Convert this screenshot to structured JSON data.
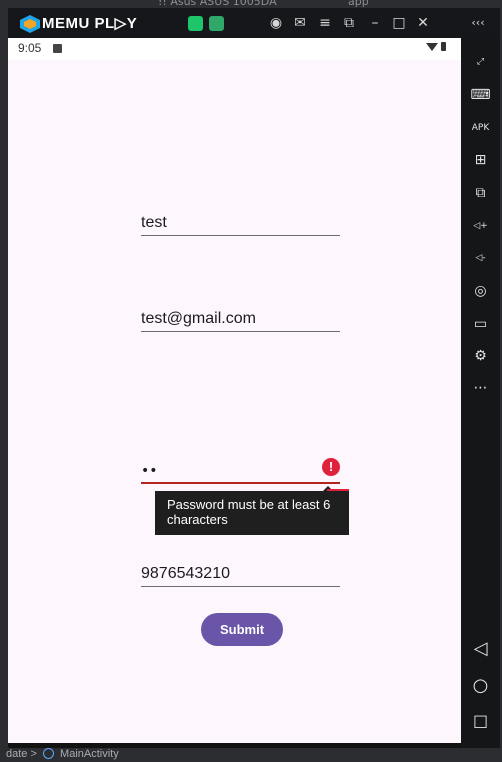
{
  "ide": {
    "top_text_left": "!! Asus ASUS 1005DA",
    "top_text_right": "app",
    "breadcrumb_left": "date",
    "breadcrumb_sep": ">",
    "breadcrumb_item": "MainActivity"
  },
  "emulator": {
    "brand": "MEMU PL▷Y",
    "titlebar_icons": [
      "account-icon",
      "mail-icon",
      "menu-icon",
      "screen-icon",
      "minimize-icon",
      "maximize-icon",
      "close-icon",
      "collapse-icon"
    ],
    "titlebar_glyphs": [
      "◉",
      "✉",
      "≡",
      "⧉",
      "–",
      "□",
      "✕",
      "‹‹‹"
    ],
    "sidebar_icons": [
      "fullscreen-icon",
      "keyboard-icon",
      "apk-icon",
      "add-app-icon",
      "multi-window-icon",
      "volume-up-icon",
      "volume-down-icon",
      "location-icon",
      "folder-icon",
      "settings-icon",
      "more-icon"
    ],
    "sidebar_glyphs": [
      "⤢",
      "⌨",
      "APK",
      "⊞",
      "⧉",
      "◁+",
      "◁-",
      "◎",
      "▭",
      "⚙",
      "⋯"
    ],
    "nav_icons": [
      "back-icon",
      "home-icon",
      "recents-icon"
    ],
    "nav_glyphs": [
      "◁",
      "○",
      "□"
    ]
  },
  "status": {
    "time": "9:05"
  },
  "form": {
    "name_value": "test",
    "email_value": "test@gmail.com",
    "password_dots": "••",
    "phone_value": "9876543210",
    "error_icon": "!",
    "error_message": "Password must be at least 6 characters",
    "submit_label": "Submit"
  },
  "colors": {
    "accent": "#6a55a8",
    "error": "#e0213c",
    "background": "#fdf7fd"
  }
}
